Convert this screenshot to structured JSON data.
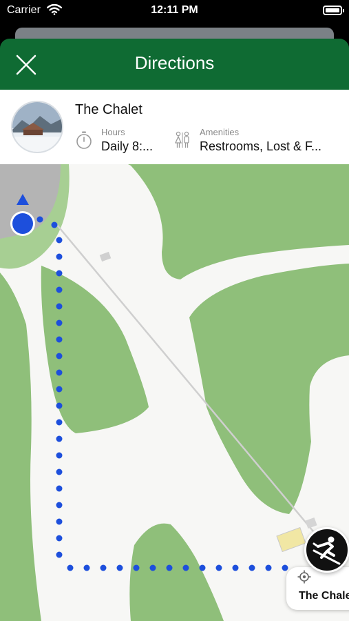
{
  "status": {
    "carrier": "Carrier",
    "time": "12:11 PM"
  },
  "header": {
    "title": "Directions",
    "close_icon": "close-icon"
  },
  "place": {
    "name": "The Chalet",
    "hours_label": "Hours",
    "hours_value": "Daily 8:...",
    "amenities_label": "Amenities",
    "amenities_value": "Restrooms, Lost & F..."
  },
  "map": {
    "marker_label": "The Chalet",
    "colors": {
      "forest": "#8fbf7a",
      "trail": "#f7f7f5",
      "route": "#1d4fdc",
      "header": "#0f6b33"
    }
  }
}
